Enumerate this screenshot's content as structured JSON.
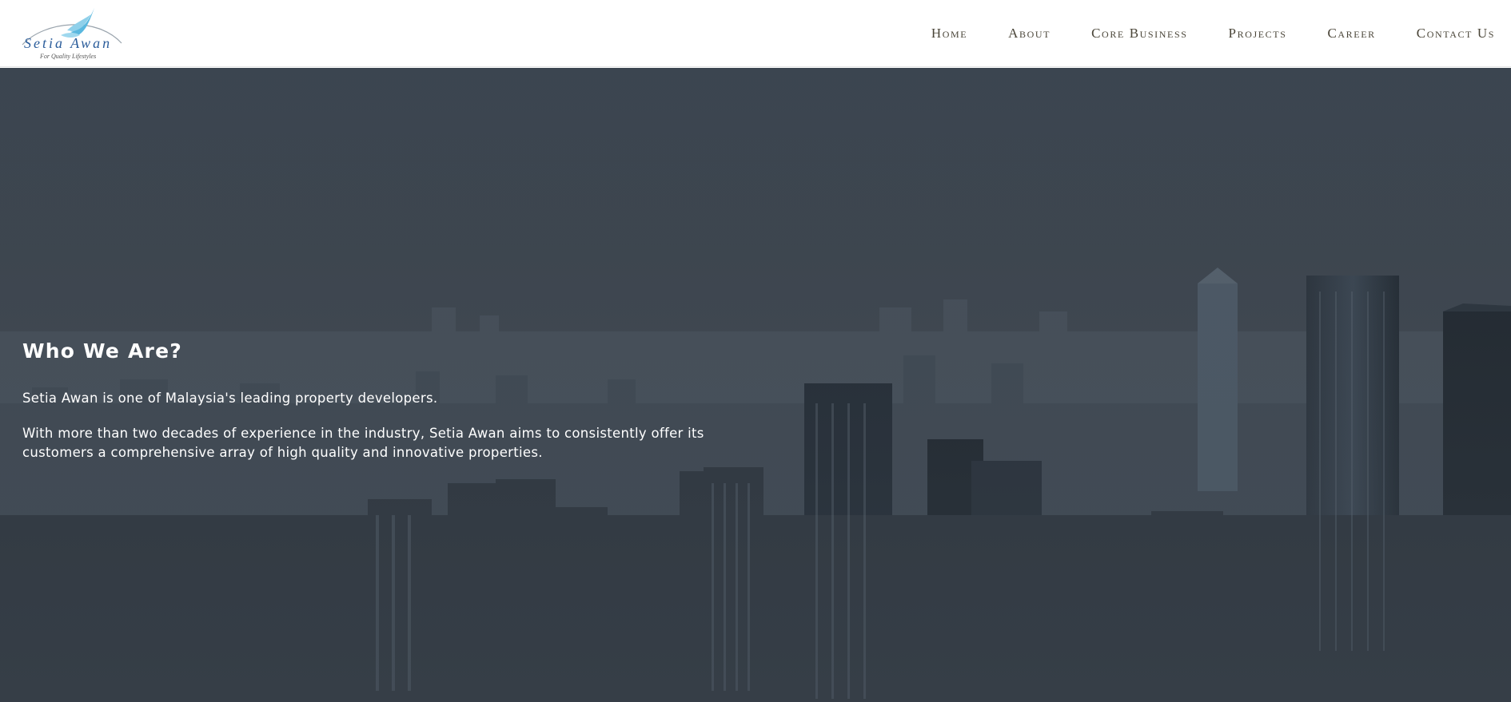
{
  "logo": {
    "name": "Setia Awan",
    "tagline": "For Quality Lifestyles"
  },
  "nav": {
    "items": [
      "Home",
      "About",
      "Core Business",
      "Projects",
      "Career",
      "Contact Us"
    ]
  },
  "hero": {
    "title": "Who We Are?",
    "paragraph_1": "Setia Awan  is one of Malaysia's leading property developers.",
    "paragraph_2": "With more than two decades of experience in the industry, Setia Awan aims to consistently offer its customers a comprehensive array of high quality and innovative properties.",
    "background": "city-skyline-image"
  },
  "colors": {
    "header_bg": "#ffffff",
    "nav_text": "#4a4538",
    "logo_blue": "#2b5d9b",
    "hero_overlay": "#3c444d",
    "hero_text": "#ffffff"
  }
}
